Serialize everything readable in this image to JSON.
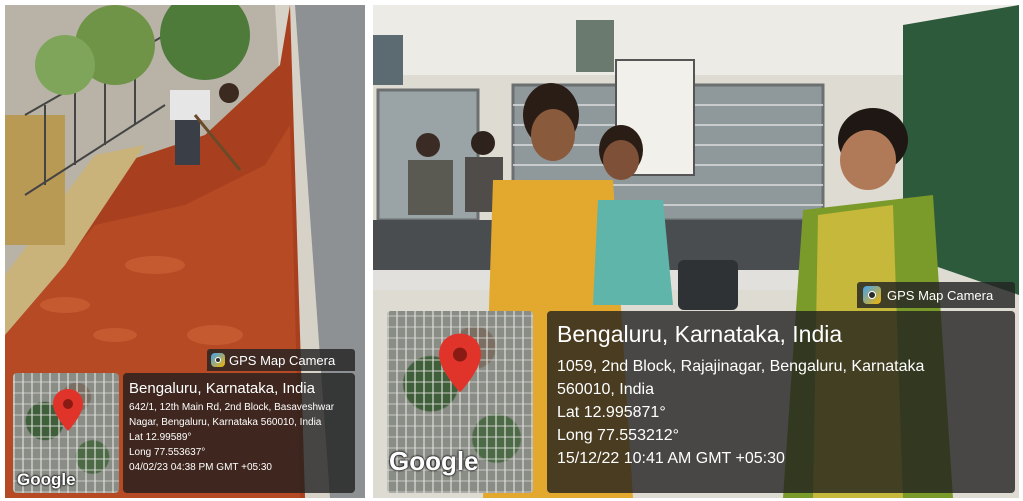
{
  "left_photo": {
    "badge": {
      "label": "GPS Map Camera",
      "icon": "gps-map-camera-icon"
    },
    "map": {
      "logo": "Google",
      "marker_icon": "location-pin-icon",
      "marker_color": "#e0342b"
    },
    "stamp": {
      "title": "Bengaluru, Karnataka, India",
      "address_line1": "642/1, 12th Main Rd, 2nd Block, Basaveshwar",
      "address_line2": "Nagar, Bengaluru, Karnataka 560010, India",
      "lat": "Lat 12.99589°",
      "long": "Long 77.553637°",
      "datetime": "04/02/23 04:38 PM GMT +05:30"
    }
  },
  "right_photo": {
    "badge": {
      "label": "GPS Map Camera",
      "icon": "gps-map-camera-icon"
    },
    "map": {
      "logo": "Google",
      "marker_icon": "location-pin-icon",
      "marker_color": "#e0342b"
    },
    "stamp": {
      "title": "Bengaluru, Karnataka, India",
      "address_line1": "1059, 2nd Block, Rajajinagar, Bengaluru, Karnataka",
      "address_line2": "560010, India",
      "lat": "Lat 12.995871°",
      "long": "Long 77.553212°",
      "datetime": "15/12/22 10:41 AM GMT +05:30"
    }
  }
}
